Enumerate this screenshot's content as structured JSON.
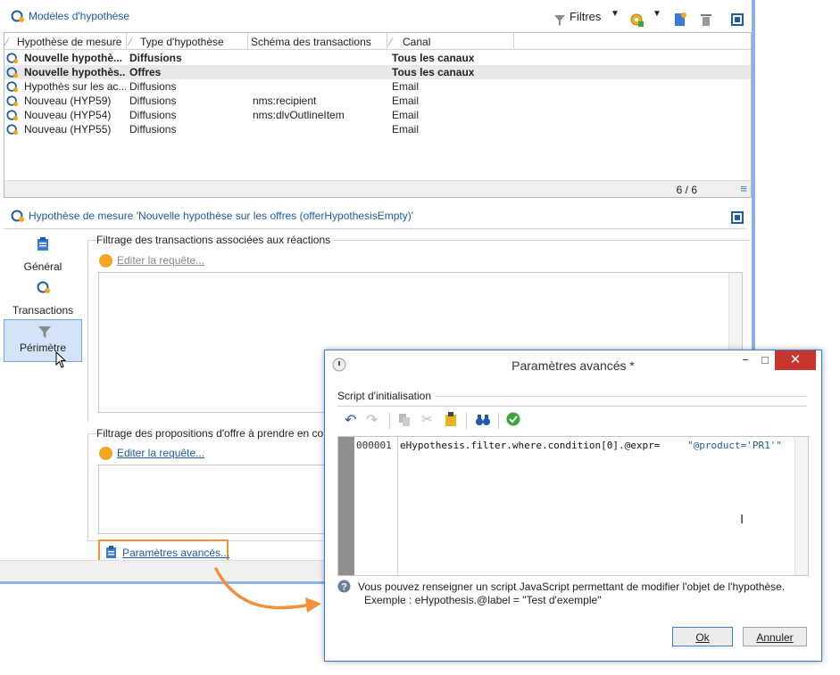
{
  "models_panel": {
    "title": "Modèles d'hypothèse",
    "filters_label": "Filtres",
    "columns": [
      "Hypothèse de mesure",
      "Type d'hypothèse",
      "Schéma des transactions",
      "Canal"
    ],
    "rows": [
      {
        "name": "Nouvelle hypothè...",
        "type": "Diffusions",
        "schema": "",
        "channel": "Tous les canaux",
        "bold": true,
        "selected": false
      },
      {
        "name": "Nouvelle hypothès...",
        "type": "Offres",
        "schema": "",
        "channel": "Tous les canaux",
        "bold": true,
        "selected": true
      },
      {
        "name": "Hypothès sur les ac...",
        "type": "Diffusions",
        "schema": "",
        "channel": "Email",
        "bold": false,
        "selected": false
      },
      {
        "name": "Nouveau (HYP59)",
        "type": "Diffusions",
        "schema": "nms:recipient",
        "channel": "Email",
        "bold": false,
        "selected": false
      },
      {
        "name": "Nouveau (HYP54)",
        "type": "Diffusions",
        "schema": "nms:dlvOutlineItem",
        "channel": "Email",
        "bold": false,
        "selected": false
      },
      {
        "name": "Nouveau (HYP55)",
        "type": "Diffusions",
        "schema": "",
        "channel": "Email",
        "bold": false,
        "selected": false
      }
    ],
    "count": "6 / 6"
  },
  "detail_panel": {
    "title": "Hypothèse de mesure 'Nouvelle hypothèse sur les offres (offerHypothesisEmpty)'",
    "sidebar": [
      {
        "label": "Général",
        "icon": "clipboard-icon"
      },
      {
        "label": "Transactions",
        "icon": "hypothesis-icon"
      },
      {
        "label": "Périmètre",
        "icon": "funnel-icon"
      }
    ],
    "group1_label": "Filtrage des transactions associées aux réactions",
    "group1_link": "Editer la requête...",
    "group2_label": "Filtrage des propositions d'offre à prendre en co",
    "group2_link": "Editer la requête...",
    "advanced_link": "Paramètres avancés..."
  },
  "dialog": {
    "title": "Paramètres avancés *",
    "section_label": "Script d'initialisation",
    "line_number": "000001",
    "code_prefix": "eHypothesis.filter.where.condition[0].@expr=",
    "code_string": "\"@product='PR1'\"",
    "help_line1": "Vous pouvez renseigner un script JavaScript permettant de modifier l'objet de l'hypothèse.",
    "help_line2": "Exemple : eHypothesis.@label = \"Test d'exemple\"",
    "ok_label": "Ok",
    "cancel_label": "Annuler"
  },
  "colors": {
    "accent": "#1f5aa6",
    "highlight_orange": "#f0923a",
    "close_red": "#c7352c"
  }
}
